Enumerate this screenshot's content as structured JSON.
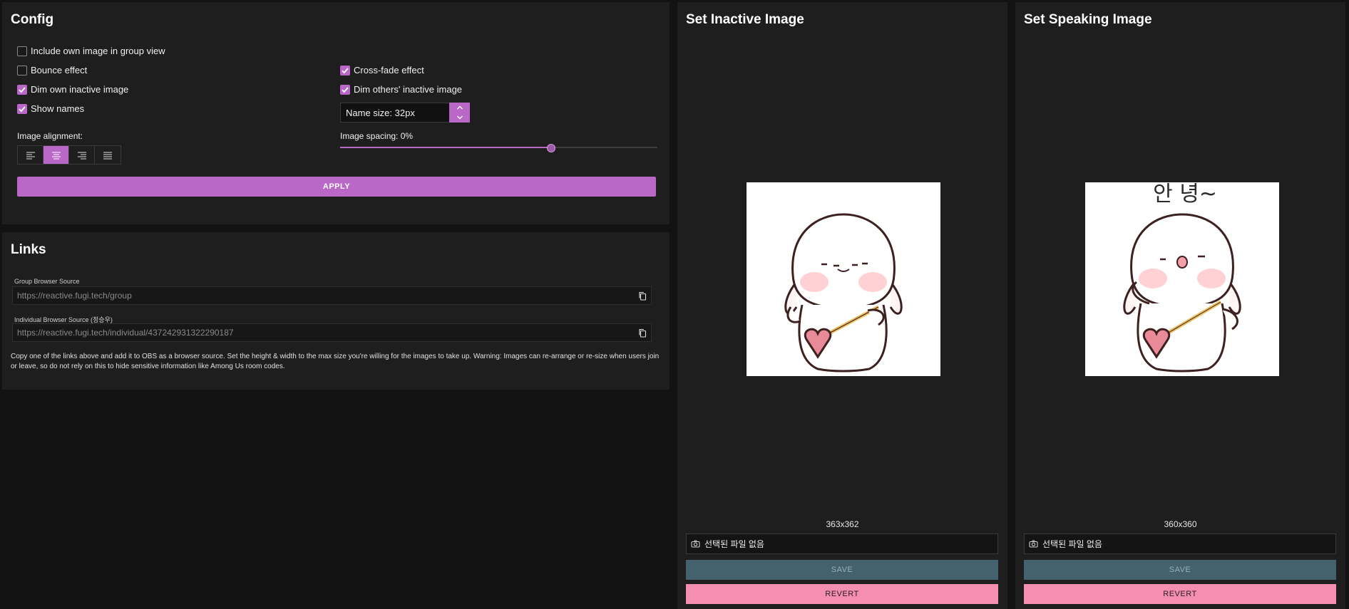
{
  "config": {
    "title": "Config",
    "checkboxes": {
      "include_own": {
        "label": "Include own image in group view",
        "checked": false
      },
      "bounce": {
        "label": "Bounce effect",
        "checked": false
      },
      "crossfade": {
        "label": "Cross-fade effect",
        "checked": true
      },
      "dim_own": {
        "label": "Dim own inactive image",
        "checked": true
      },
      "dim_others": {
        "label": "Dim others' inactive image",
        "checked": true
      },
      "show_names": {
        "label": "Show names",
        "checked": true
      }
    },
    "name_size_label": "Name size: 32px",
    "image_alignment_label": "Image alignment:",
    "alignment_options": [
      "align-left",
      "align-center",
      "align-right",
      "align-justify"
    ],
    "alignment_selected": "align-center",
    "image_spacing_label": "Image spacing: 0%",
    "image_spacing_slider_fraction": 0.665,
    "apply_label": "APPLY",
    "accent_color": "#ba68c8"
  },
  "links": {
    "title": "Links",
    "group_label": "Group Browser Source",
    "group_url": "https://reactive.fugi.tech/group",
    "individual_label": "Individual Browser Source (정승우)",
    "individual_url": "https://reactive.fugi.tech/individual/437242931322290187",
    "help_text": "Copy one of the links above and add it to OBS as a browser source. Set the height & width to the max size you're willing for the images to take up. Warning: Images can re-arrange or re-size when users join or leave, so do not rely on this to hide sensitive information like Among Us room codes."
  },
  "inactive": {
    "title": "Set Inactive Image",
    "dimensions": "363x362",
    "file_placeholder": "선택된 파일 없음",
    "save_label": "SAVE",
    "revert_label": "REVERT"
  },
  "speaking": {
    "title": "Set Speaking Image",
    "image_caption": "안 녕~",
    "dimensions": "360x360",
    "file_placeholder": "선택된 파일 없음",
    "save_label": "SAVE",
    "revert_label": "REVERT"
  },
  "colors": {
    "save_button": "#44626e",
    "revert_button": "#f48fb1",
    "panel_bg": "#1e1e1e",
    "page_bg": "#121212"
  }
}
